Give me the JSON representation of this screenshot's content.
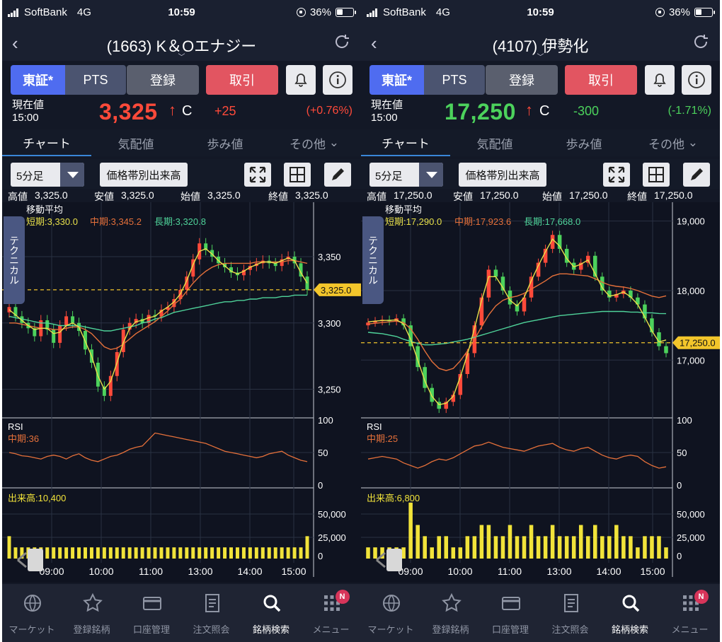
{
  "status": {
    "carrier": "SoftBank",
    "network": "4G",
    "time": "10:59",
    "battery": "36%"
  },
  "colors": {
    "up": "#ff4a3a",
    "down": "#4cd25c",
    "short": "#e8e04a",
    "mid": "#e5703a",
    "long": "#4fd39a",
    "volume": "#f1e33a",
    "accent": "#3a86d8",
    "current": "#f3c62b"
  },
  "common": {
    "exchange": "東証*",
    "pts": "PTS",
    "register": "登録",
    "trade": "取引",
    "price_label_1": "現在値",
    "price_time": "15:00",
    "status_c": "C",
    "tabs": [
      "チャート",
      "気配値",
      "歩み値",
      "その他"
    ],
    "interval": "5分足",
    "volume_by_price": "価格帯別出来高",
    "high": "高値",
    "low": "安値",
    "open": "始値",
    "close": "終値",
    "ma_title": "移動平均",
    "technical": "テクニカル",
    "rsi": "RSI",
    "nav": [
      "マーケット",
      "登録銘柄",
      "口座管理",
      "注文照会",
      "銘柄検索",
      "メニュー"
    ],
    "badge": "N",
    "x_ticks": [
      "09:00",
      "10:00",
      "11:00",
      "13:00",
      "14:00",
      "15:00"
    ],
    "rsi_ticks": [
      "100",
      "50",
      "0"
    ],
    "vol_ticks": [
      "50,000",
      "25,000",
      "0"
    ]
  },
  "screens": [
    {
      "code": "(1663)",
      "name": "K＆Oエナジー",
      "price": "3,325",
      "arrow": "↑",
      "change": "+25",
      "pct": "(+0.76%)",
      "high": "3,325.0",
      "low": "3,325.0",
      "open": "3,325.0",
      "close": "3,325.0",
      "ma_short": "短期:3,330.0",
      "ma_mid": "中期:3,345.2",
      "ma_long": "長期:3,320.8",
      "current_tag": "3,325.0",
      "y_ticks": [
        "3,350",
        "3,300",
        "3,250"
      ],
      "rsi_mid": "中期:36",
      "volume": "出来高:10,400"
    },
    {
      "code": "(4107)",
      "name": "伊勢化",
      "price": "17,250",
      "arrow": "↑",
      "change": "-300",
      "pct": "(-1.71%)",
      "high": "17,250.0",
      "low": "17,250.0",
      "open": "17,250.0",
      "close": "17,250.0",
      "ma_short": "短期:17,290.0",
      "ma_mid": "中期:17,923.6",
      "ma_long": "長期:17,668.0",
      "current_tag": "17,250.0",
      "y_ticks": [
        "19,000",
        "18,000",
        "17,000"
      ],
      "rsi_mid": "中期:25",
      "volume": "出来高:6,800"
    }
  ],
  "chart_data": [
    {
      "type": "candlestick",
      "title": "(1663) K＆Oエナジー 5分足",
      "y_ticks": [
        3350,
        3300,
        3250
      ],
      "current": 3325,
      "close_series": [
        3312,
        3305,
        3300,
        3296,
        3290,
        3302,
        3295,
        3285,
        3298,
        3305,
        3300,
        3294,
        3280,
        3270,
        3252,
        3245,
        3260,
        3278,
        3295,
        3300,
        3303,
        3300,
        3306,
        3305,
        3310,
        3312,
        3318,
        3325,
        3335,
        3348,
        3360,
        3355,
        3350,
        3345,
        3342,
        3338,
        3336,
        3340,
        3343,
        3345,
        3347,
        3345,
        3343,
        3348,
        3350,
        3345,
        3335,
        3325
      ],
      "ma_short": [
        3310,
        3306,
        3302,
        3298,
        3295,
        3296,
        3296,
        3292,
        3293,
        3298,
        3300,
        3297,
        3286,
        3275,
        3260,
        3250,
        3256,
        3270,
        3285,
        3296,
        3301,
        3302,
        3304,
        3305,
        3309,
        3312,
        3316,
        3322,
        3332,
        3344,
        3354,
        3356,
        3352,
        3347,
        3343,
        3339,
        3337,
        3339,
        3342,
        3344,
        3346,
        3346,
        3345,
        3347,
        3349,
        3347,
        3338,
        3330
      ],
      "ma_mid": [
        3300,
        3300,
        3299,
        3298,
        3297,
        3296,
        3296,
        3295,
        3295,
        3296,
        3297,
        3297,
        3295,
        3292,
        3287,
        3282,
        3280,
        3281,
        3284,
        3288,
        3292,
        3295,
        3298,
        3301,
        3305,
        3309,
        3314,
        3318,
        3324,
        3330,
        3335,
        3339,
        3342,
        3344,
        3345,
        3345,
        3345,
        3345,
        3345,
        3346,
        3346,
        3346,
        3346,
        3346,
        3347,
        3347,
        3346,
        3345
      ],
      "ma_long": [
        3305,
        3304,
        3303,
        3302,
        3301,
        3300,
        3300,
        3299,
        3298,
        3298,
        3298,
        3298,
        3297,
        3296,
        3295,
        3294,
        3294,
        3295,
        3296,
        3297,
        3298,
        3300,
        3301,
        3303,
        3304,
        3306,
        3308,
        3309,
        3310,
        3311,
        3312,
        3313,
        3314,
        3315,
        3316,
        3316,
        3317,
        3317,
        3318,
        3318,
        3319,
        3319,
        3319,
        3320,
        3320,
        3321,
        3321,
        3321
      ],
      "rsi": [
        50,
        48,
        45,
        44,
        42,
        40,
        44,
        46,
        44,
        40,
        45,
        48,
        42,
        38,
        36,
        40,
        44,
        46,
        50,
        55,
        58,
        60,
        70,
        80,
        78,
        76,
        74,
        72,
        70,
        68,
        66,
        64,
        60,
        56,
        52,
        50,
        48,
        46,
        44,
        42,
        44,
        48,
        50,
        52,
        46,
        42,
        38,
        36
      ],
      "volume": [
        2,
        1,
        1,
        1,
        1,
        1,
        1,
        1,
        1,
        1,
        1,
        1,
        1,
        1,
        1,
        1,
        1,
        1,
        1,
        1,
        1,
        1,
        1,
        1,
        1,
        1,
        1,
        1,
        1,
        1,
        1,
        1,
        1,
        1,
        1,
        1,
        1,
        1,
        1,
        1,
        1,
        1,
        1,
        1,
        1,
        1,
        1,
        2
      ]
    },
    {
      "type": "candlestick",
      "title": "(4107) 伊勢化 5分足",
      "y_ticks": [
        19000,
        18000,
        17000
      ],
      "current": 17250,
      "close_series": [
        17540,
        17560,
        17580,
        17560,
        17600,
        17500,
        17200,
        16900,
        16600,
        16400,
        16300,
        16400,
        16500,
        16800,
        17100,
        17500,
        17900,
        18300,
        18200,
        18000,
        17800,
        17700,
        17900,
        18200,
        18400,
        18600,
        18800,
        18600,
        18400,
        18300,
        18400,
        18500,
        18200,
        18000,
        17900,
        17950,
        18000,
        17900,
        17800,
        17600,
        17400,
        17200,
        17100
      ],
      "ma_short": [
        17550,
        17560,
        17570,
        17570,
        17580,
        17520,
        17300,
        17000,
        16700,
        16480,
        16360,
        16380,
        16480,
        16760,
        17080,
        17460,
        17860,
        18200,
        18200,
        18040,
        17860,
        17780,
        17900,
        18140,
        18360,
        18560,
        18740,
        18640,
        18460,
        18340,
        18380,
        18440,
        18240,
        18040,
        17920,
        17940,
        17980,
        17910,
        17800,
        17620,
        17420,
        17260,
        17290
      ],
      "ma_mid": [
        17520,
        17530,
        17540,
        17550,
        17560,
        17540,
        17450,
        17300,
        17130,
        16980,
        16880,
        16850,
        16880,
        16990,
        17130,
        17300,
        17480,
        17650,
        17780,
        17860,
        17900,
        17920,
        17960,
        18020,
        18080,
        18140,
        18210,
        18240,
        18240,
        18230,
        18220,
        18210,
        18170,
        18120,
        18080,
        18060,
        18050,
        18030,
        18000,
        17960,
        17920,
        17900,
        17924
      ],
      "ma_long": [
        17400,
        17390,
        17380,
        17360,
        17340,
        17300,
        17270,
        17240,
        17220,
        17220,
        17230,
        17240,
        17260,
        17280,
        17300,
        17330,
        17360,
        17390,
        17420,
        17450,
        17480,
        17510,
        17540,
        17560,
        17580,
        17600,
        17620,
        17640,
        17650,
        17660,
        17670,
        17680,
        17690,
        17700,
        17700,
        17700,
        17700,
        17690,
        17690,
        17680,
        17680,
        17670,
        17668
      ],
      "rsi": [
        40,
        42,
        44,
        42,
        40,
        34,
        30,
        26,
        30,
        36,
        40,
        38,
        42,
        48,
        54,
        60,
        62,
        66,
        62,
        58,
        56,
        54,
        52,
        56,
        60,
        62,
        64,
        58,
        54,
        52,
        56,
        58,
        52,
        46,
        42,
        40,
        44,
        46,
        44,
        36,
        30,
        26,
        28
      ],
      "volume": [
        1,
        1,
        1,
        1,
        1,
        1,
        5,
        3,
        2,
        1,
        2,
        2,
        1,
        1,
        2,
        2,
        3,
        3,
        2,
        2,
        3,
        2,
        2,
        3,
        2,
        2,
        3,
        2,
        2,
        2,
        3,
        2,
        3,
        2,
        2,
        3,
        2,
        2,
        1,
        2,
        2,
        2,
        1
      ]
    }
  ]
}
